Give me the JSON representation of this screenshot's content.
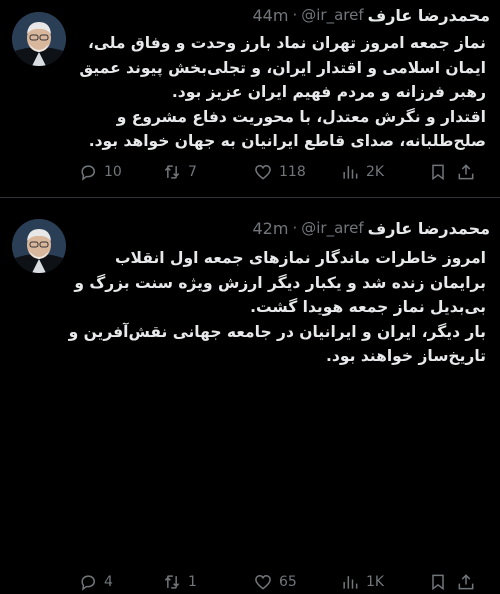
{
  "tweets": [
    {
      "author_name": "محمدرضا عارف",
      "handle": "@ir_aref",
      "separator": "·",
      "time": "44m",
      "lines": [
        "نماز جمعه امروز تهران نماد بارز وحدت و وفاق ملی،",
        "ایمان اسلامی و اقتدار ایران، و تجلی‌بخش پیوند عمیق",
        "رهبر فرزانه و مردم فهیم ایران عزیز بود.",
        "اقتدار و نگرش معتدل، با محوریت دفاع مشروع و",
        "صلح‌طلبانه، صدای قاطع ایرانیان به جهان خواهد بود."
      ],
      "replies": "10",
      "retweets": "7",
      "likes": "118",
      "views": "2K"
    },
    {
      "author_name": "محمدرضا عارف",
      "handle": "@ir_aref",
      "separator": "·",
      "time": "42m",
      "lines": [
        "امروز خاطرات ماندگار نمازهای جمعه اول انقلاب",
        "برایمان زنده شد و یکبار دیگر ارزش ویژه سنت بزرگ و",
        "بی‌بدیل نماز جمعه هویدا گشت.",
        "بار دیگر، ایران و ایرانیان در جامعه جهانی نقش‌آفرین و",
        "تاریخ‌ساز خواهند بود."
      ],
      "replies": "4",
      "retweets": "1",
      "likes": "65",
      "views": "1K"
    }
  ],
  "icons": {
    "reply": "speech-bubble",
    "retweet": "retweet-arrows",
    "like": "heart",
    "views": "bar-chart",
    "bookmark": "bookmark",
    "share": "share-upload"
  },
  "colors": {
    "background": "#000000",
    "text": "#e7e9ea",
    "muted": "#71767b",
    "divider": "#2f3336"
  }
}
